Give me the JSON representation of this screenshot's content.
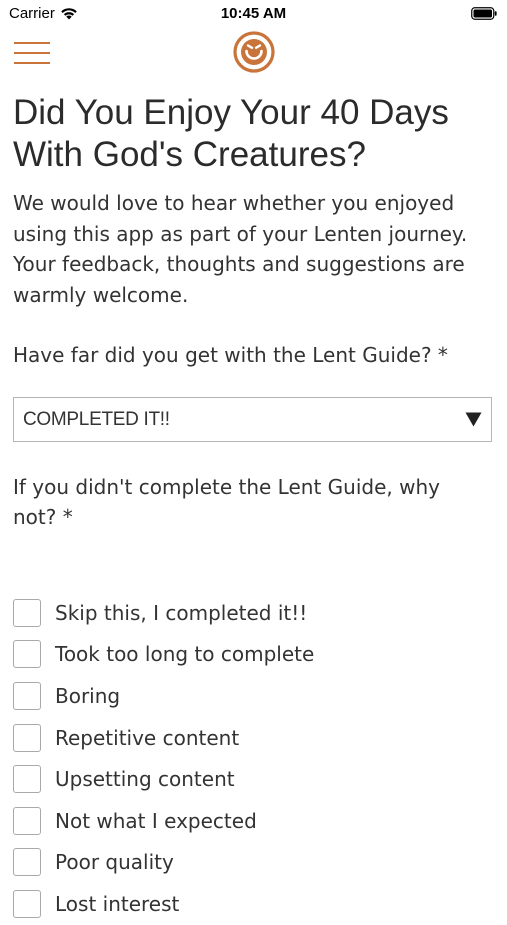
{
  "status_bar": {
    "carrier": "Carrier",
    "time": "10:45 AM"
  },
  "nav": {
    "menu_icon": "hamburger-menu-icon",
    "logo_icon": "smiling-face-logo",
    "accent_color": "#c8743a"
  },
  "page": {
    "title": "Did You Enjoy Your 40 Days With God's Creatures?",
    "intro": "We would love to hear whether you enjoyed using this app as part of your Lenten journey. Your feedback, thoughts and suggestions are warmly welcome."
  },
  "form": {
    "q1": {
      "label": "Have far did you get with the Lent Guide? *",
      "selected_value": "COMPLETED IT!!"
    },
    "q2": {
      "label": "If you didn't complete the Lent Guide, why not? *",
      "options": [
        "Skip this, I completed it!!",
        "Took too long to complete",
        "Boring",
        "Repetitive content",
        "Upsetting content",
        "Not what I expected",
        "Poor quality",
        "Lost interest"
      ]
    }
  }
}
